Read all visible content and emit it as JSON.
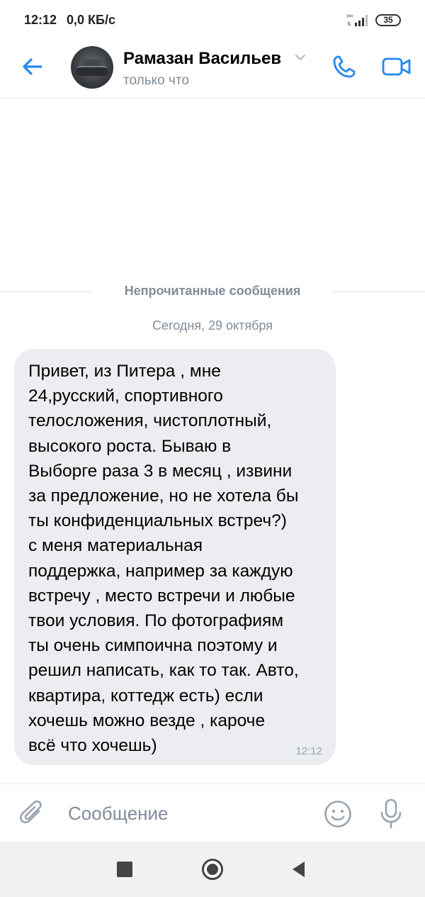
{
  "status_bar": {
    "time": "12:12",
    "network_speed": "0,0 КБ/с",
    "battery": "35",
    "signal_icon": "signal-icon",
    "battery_icon": "battery-icon"
  },
  "header": {
    "contact_name": "Рамазан Васильев",
    "contact_status": "только что",
    "back_icon": "arrow-left-icon",
    "call_icon": "phone-icon",
    "video_icon": "video-camera-icon",
    "accent_color": "#2688eb"
  },
  "chat": {
    "unread_divider": "Непрочитанные сообщения",
    "date": "Сегодня, 29 октября",
    "messages": [
      {
        "text": "Привет, из Питера , мне\n24,русский, спортивного\nтелосложения, чистоплотный,\nвысокого роста. Бываю в\nВыборге раза 3 в месяц , извини\nза предложение, но не хотела бы\nты конфиденциальных встреч?)\nс меня материальная\nподдержка, например за каждую\nвстречу , место встречи и любые\nтвои условия. По фотографиям\nты очень симпоична поэтому и\nрешил написать, как то так. Авто,\nквартира, коттедж есть) если\nхочешь можно везде , кароче\nвсё что хочешь)",
        "time": "12:12"
      }
    ]
  },
  "composer": {
    "placeholder": "Сообщение",
    "attach_icon": "paperclip-icon",
    "emoji_icon": "smile-icon",
    "mic_icon": "microphone-icon"
  },
  "nav_bar": {
    "recents_icon": "square-icon",
    "home_icon": "circle-icon",
    "back_icon": "triangle-back-icon"
  }
}
